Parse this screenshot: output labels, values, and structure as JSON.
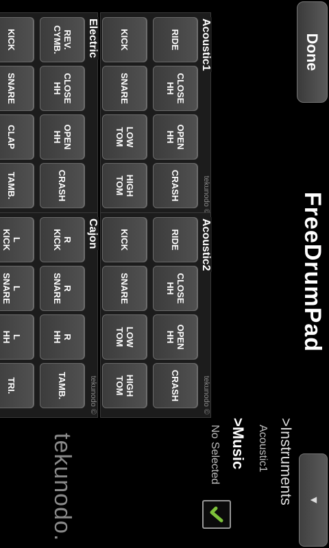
{
  "toolbar": {
    "done_label": "Done",
    "menu_glyph": "▼"
  },
  "app_title": "FreeDrumPad",
  "credit": "tekunodo ©",
  "panels": {
    "acoustic1": {
      "title": "Acoustic1",
      "pads": [
        "RIDE",
        "CLOSE\nHH",
        "OPEN\nHH",
        "CRASH",
        "KICK",
        "SNARE",
        "LOW\nTOM",
        "HIGH\nTOM"
      ]
    },
    "acoustic2": {
      "title": "Acoustic2",
      "pads": [
        "RIDE",
        "CLOSE\nHH",
        "OPEN\nHH",
        "CRASH",
        "KICK",
        "SNARE",
        "LOW\nTOM",
        "HIGH\nTOM"
      ]
    },
    "electric": {
      "title": "Electric",
      "pads": [
        "REV.\nCYMB.",
        "CLOSE\nHH",
        "OPEN\nHH",
        "CRASH",
        "KICK",
        "SNARE",
        "CLAP",
        "TAMB."
      ]
    },
    "cajon": {
      "title": "Cajon",
      "pads": [
        "R\nKICK",
        "R\nSNARE",
        "R\nHH",
        "TAMB.",
        "L\nKICK",
        "L\nSNARE",
        "L\nHH",
        "TRI."
      ]
    }
  },
  "instruments": {
    "label": ">Instruments",
    "value": "Acoustic1"
  },
  "music": {
    "label": ">Music",
    "value": "No Selected",
    "checked": true
  },
  "logo_text": "tekunodo.",
  "colors": {
    "check": "#7dc23a"
  }
}
